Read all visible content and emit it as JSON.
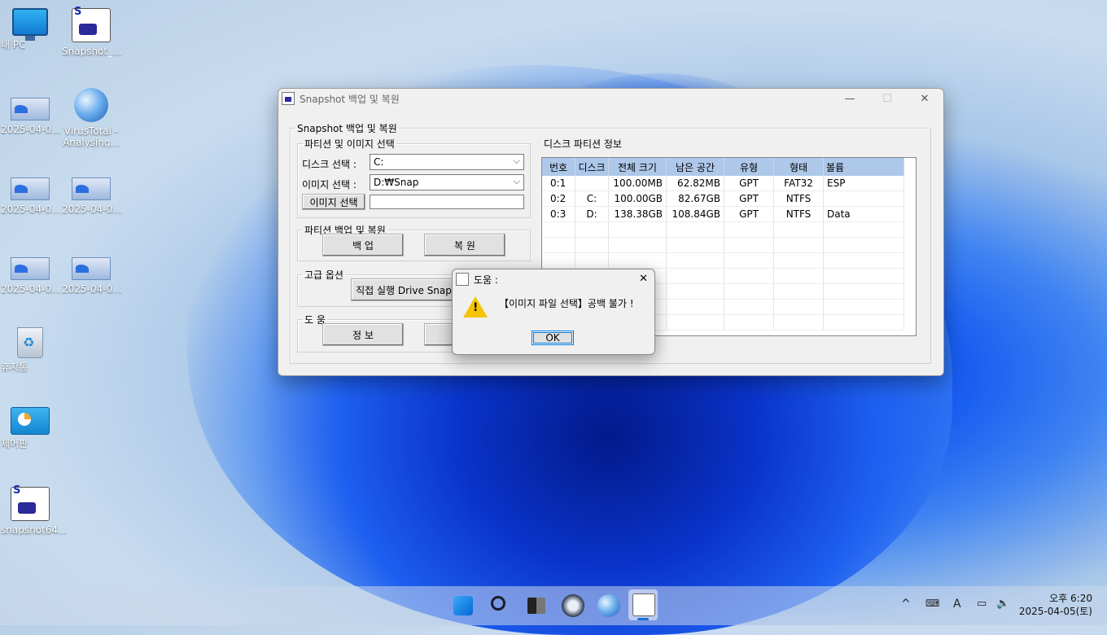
{
  "desktop": {
    "icons": [
      {
        "label": "내 PC"
      },
      {
        "label": "Snapshot_..."
      },
      {
        "label": "2025-04-0..."
      },
      {
        "label": "VirusTotal - Analysing..."
      },
      {
        "label": "2025-04-0..."
      },
      {
        "label": "2025-04-0..."
      },
      {
        "label": "2025-04-0..."
      },
      {
        "label": "2025-04-0..."
      },
      {
        "label": "휴지통"
      },
      {
        "label": "제어판"
      },
      {
        "label": "snapshot64..."
      }
    ]
  },
  "window": {
    "title": "Snapshot 백업 및 복원",
    "minimize": "—",
    "maximize": "☐",
    "close": "✕",
    "main_group": "Snapshot 백업 및 복원",
    "partition_group": "파티션 및 이미지 선택",
    "disk_label": "디스크 선택 :",
    "disk_value": "C:",
    "image_label": "이미지 선택 :",
    "image_value": "D:₩Snap",
    "image_select_button": "이미지 선택",
    "image_path": "",
    "backup_group": "파티션 백업 및 복원",
    "backup_button": "백    업",
    "restore_button": "복    원",
    "advanced_group": "고급 옵션",
    "direct_button": "직접 실행 Drive Snap",
    "help_group": "도  움",
    "info_button": "정    보",
    "disk_info_group": "디스크 파티션 정보",
    "table": {
      "headers": [
        "번호",
        "디스크",
        "전체 크기",
        "남은 공간",
        "유형",
        "형태",
        "볼륨"
      ],
      "rows": [
        [
          "0:1",
          "",
          "100.00MB",
          "62.82MB",
          "GPT",
          "FAT32",
          "ESP"
        ],
        [
          "0:2",
          "C:",
          "100.00GB",
          "82.67GB",
          "GPT",
          "NTFS",
          ""
        ],
        [
          "0:3",
          "D:",
          "138.38GB",
          "108.84GB",
          "GPT",
          "NTFS",
          "Data"
        ]
      ]
    }
  },
  "dialog": {
    "title": "도움 :",
    "close": "✕",
    "message": "【이미지 파일 선택】공백 불가 !",
    "ok": "OK"
  },
  "taskbar": {
    "time": "오후 6:20",
    "date": "2025-04-05(토)",
    "tray_chevron": "^",
    "ime": "A"
  }
}
